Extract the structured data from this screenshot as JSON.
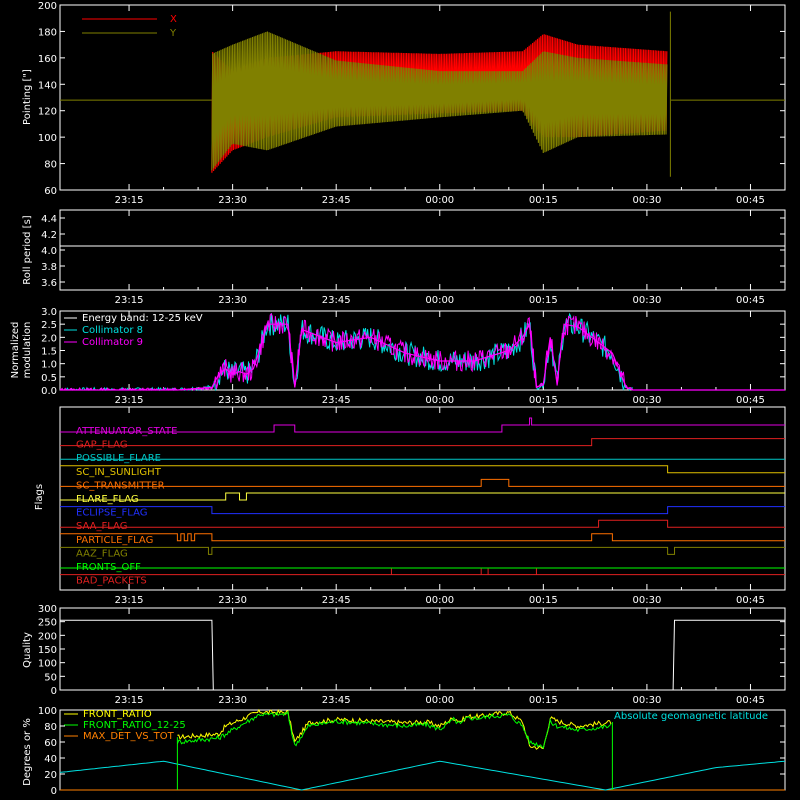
{
  "colors": {
    "background": "#000000",
    "axes": "#ffffff",
    "x_pointing": "#ff0000",
    "y_pointing": "#808000",
    "collimator8": "#00e0e0",
    "collimator9": "#ff00ff",
    "front_ratio": "#ffff00",
    "front_ratio_12_25": "#00ff00",
    "max_det_vs_tot": "#ff8000",
    "geomag": "#00e0e0"
  },
  "time_axis": {
    "ticks": [
      "23:15",
      "23:30",
      "23:45",
      "00:00",
      "00:15",
      "00:30",
      "00:45"
    ],
    "tick_minutes": [
      15,
      30,
      45,
      60,
      75,
      90,
      105
    ],
    "range_minutes": [
      5,
      110
    ]
  },
  "chart_data": [
    {
      "type": "line",
      "panel": "pointing",
      "ylabel": "Pointing [\"]",
      "ylim": [
        60,
        200
      ],
      "yticks": [
        "60",
        "80",
        "100",
        "120",
        "140",
        "160",
        "180",
        "200"
      ],
      "ytick_values": [
        60,
        80,
        100,
        120,
        140,
        160,
        180,
        200
      ],
      "legend_position": "top-left",
      "series": [
        {
          "name": "X",
          "x_min": [
            27,
            30,
            35,
            45,
            60,
            72,
            75,
            80,
            93
          ],
          "upper": [
            165,
            150,
            160,
            165,
            163,
            165,
            178,
            170,
            165
          ],
          "lower": [
            73,
            90,
            100,
            115,
            118,
            120,
            100,
            100,
            105
          ]
        },
        {
          "name": "Y",
          "x_min": [
            27,
            30,
            35,
            45,
            60,
            72,
            75,
            80,
            93
          ],
          "upper": [
            163,
            170,
            180,
            158,
            150,
            150,
            165,
            160,
            155
          ],
          "lower": [
            75,
            95,
            90,
            108,
            115,
            120,
            88,
            100,
            102
          ]
        }
      ],
      "baseline": 128
    },
    {
      "type": "line",
      "panel": "roll",
      "ylabel": "Roll period [s]",
      "ylim": [
        3.5,
        4.5
      ],
      "yticks": [
        "3.6",
        "3.8",
        "4.0",
        "4.2",
        "4.4"
      ],
      "ytick_values": [
        3.6,
        3.8,
        4.0,
        4.2,
        4.4
      ],
      "series": [
        {
          "name": "",
          "x": [
            5,
            110
          ],
          "y": [
            4.05,
            4.05
          ]
        }
      ]
    },
    {
      "type": "line",
      "panel": "modulation",
      "ylabel": [
        "Normalized",
        "modulation"
      ],
      "ylim": [
        0,
        3.0
      ],
      "yticks": [
        "0.0",
        "0.5",
        "1.0",
        "1.5",
        "2.0",
        "2.5",
        "3.0"
      ],
      "ytick_values": [
        0,
        0.5,
        1.0,
        1.5,
        2.0,
        2.5,
        3.0
      ],
      "legend_title": "Energy band: 12-25 keV",
      "legend_position": "top-left",
      "envelope_x": [
        5,
        22,
        27,
        28,
        29,
        30,
        31,
        32,
        33,
        34,
        35,
        38,
        39,
        40,
        45,
        50,
        55,
        60,
        65,
        70,
        72,
        73,
        74,
        75,
        76,
        77,
        78,
        80,
        82,
        85,
        87,
        88,
        110
      ],
      "envelope_y": [
        0,
        0,
        0.1,
        0.6,
        0.8,
        0.6,
        0.7,
        0.6,
        0.8,
        1.6,
        2.5,
        2.5,
        0.1,
        2.3,
        1.8,
        2.0,
        1.4,
        1.1,
        1.1,
        1.5,
        2.0,
        2.5,
        0.1,
        0.2,
        2.0,
        0.3,
        2.5,
        2.4,
        2.0,
        1.4,
        0.1,
        0,
        0
      ],
      "series": [
        {
          "name": "Collimator 8"
        },
        {
          "name": "Collimator 9"
        }
      ]
    },
    {
      "type": "line",
      "panel": "flags",
      "ylabel": "Flags",
      "series": [
        {
          "name": "ATTENUATOR_STATE",
          "color": "#e000e0",
          "steps": [
            [
              5,
              0
            ],
            [
              36,
              1
            ],
            [
              39,
              0
            ],
            [
              69,
              1
            ],
            [
              73,
              2
            ],
            [
              73.3,
              1
            ],
            [
              110,
              1
            ]
          ]
        },
        {
          "name": "GAP_FLAG",
          "color": "#e02020",
          "steps": [
            [
              5,
              0
            ],
            [
              82,
              1
            ],
            [
              110,
              1
            ]
          ]
        },
        {
          "name": "POSSIBLE_FLARE",
          "color": "#00c8c8",
          "steps": [
            [
              5,
              0
            ],
            [
              110,
              0
            ]
          ]
        },
        {
          "name": "SC_IN_SUNLIGHT",
          "color": "#e0c000",
          "steps": [
            [
              5,
              1
            ],
            [
              93,
              0
            ],
            [
              110,
              0
            ]
          ]
        },
        {
          "name": "SC_TRANSMITTER",
          "color": "#ff7000",
          "steps": [
            [
              5,
              0
            ],
            [
              66,
              1
            ],
            [
              70,
              0
            ],
            [
              110,
              0
            ]
          ]
        },
        {
          "name": "FLARE_FLAG",
          "color": "#ffff40",
          "steps": [
            [
              5,
              0
            ],
            [
              29,
              1
            ],
            [
              31,
              0
            ],
            [
              32,
              1
            ],
            [
              110,
              1
            ]
          ]
        },
        {
          "name": "ECLIPSE_FLAG",
          "color": "#2030ff",
          "steps": [
            [
              5,
              1
            ],
            [
              27,
              0
            ],
            [
              93,
              1
            ],
            [
              110,
              1
            ]
          ]
        },
        {
          "name": "SAA_FLAG",
          "color": "#e02020",
          "steps": [
            [
              5,
              0
            ],
            [
              83,
              1
            ],
            [
              93,
              0
            ],
            [
              110,
              0
            ]
          ]
        },
        {
          "name": "PARTICLE_FLAG",
          "color": "#ff7000",
          "steps": [
            [
              5,
              1
            ],
            [
              22,
              0
            ],
            [
              22.5,
              1
            ],
            [
              23,
              0
            ],
            [
              23.5,
              1
            ],
            [
              24,
              0
            ],
            [
              24.5,
              1
            ],
            [
              27,
              0
            ],
            [
              82,
              1
            ],
            [
              85,
              0
            ],
            [
              110,
              0
            ]
          ]
        },
        {
          "name": "AAZ_FLAG",
          "color": "#808000",
          "steps": [
            [
              5,
              1
            ],
            [
              26.5,
              0
            ],
            [
              27,
              1
            ],
            [
              93,
              0
            ],
            [
              94,
              1
            ],
            [
              110,
              1
            ]
          ]
        },
        {
          "name": "FRONTS_OFF",
          "color": "#00ff00",
          "steps": [
            [
              5,
              0
            ],
            [
              110,
              0
            ]
          ]
        },
        {
          "name": "BAD_PACKETS",
          "color": "#e02020",
          "steps": [
            [
              5,
              1
            ],
            [
              110,
              1
            ]
          ],
          "spikes": [
            53,
            66,
            67,
            74
          ]
        }
      ]
    },
    {
      "type": "line",
      "panel": "quality",
      "ylabel": "Quality",
      "ylim": [
        0,
        300
      ],
      "yticks": [
        "0",
        "50",
        "100",
        "150",
        "200",
        "250",
        "300"
      ],
      "ytick_values": [
        0,
        50,
        100,
        150,
        200,
        250,
        300
      ],
      "series": [
        {
          "name": "",
          "x": [
            5,
            27,
            27.2,
            93.8,
            94,
            110
          ],
          "y": [
            255,
            255,
            0,
            0,
            255,
            255
          ]
        }
      ]
    },
    {
      "type": "line",
      "panel": "ratios",
      "ylabel": "Degrees or %",
      "ylim": [
        0,
        100
      ],
      "yticks": [
        "0",
        "20",
        "40",
        "60",
        "80",
        "100"
      ],
      "ytick_values": [
        0,
        20,
        40,
        60,
        80,
        100
      ],
      "annotation": "Absolute geomagnetic latitude",
      "series": [
        {
          "name": "FRONT_RATIO",
          "x": [
            22,
            28,
            29,
            33,
            34,
            35,
            38,
            39,
            41,
            45,
            55,
            58,
            60,
            62,
            63,
            64,
            66,
            67,
            70,
            72,
            73,
            75,
            76,
            77,
            80,
            85
          ],
          "y": [
            66,
            70,
            80,
            95,
            98,
            97,
            97,
            60,
            84,
            88,
            84,
            85,
            80,
            90,
            86,
            92,
            92,
            94,
            97,
            85,
            55,
            52,
            90,
            86,
            80,
            85
          ]
        },
        {
          "name": "FRONT_RATIO_12-25",
          "x": [
            22,
            28,
            29,
            33,
            34,
            35,
            38,
            39,
            41,
            45,
            55,
            58,
            60,
            62,
            63,
            64,
            66,
            67,
            70,
            72,
            73,
            75,
            76,
            77,
            80,
            85
          ],
          "y": [
            60,
            65,
            70,
            90,
            95,
            94,
            95,
            55,
            80,
            86,
            80,
            82,
            76,
            88,
            82,
            90,
            90,
            92,
            94,
            80,
            60,
            55,
            85,
            80,
            75,
            80
          ]
        },
        {
          "name": "MAX_DET_VS_TOT",
          "x": [
            5,
            110
          ],
          "y": [
            0,
            0
          ]
        },
        {
          "name": "Absolute geomagnetic latitude",
          "x": [
            5,
            20,
            40,
            60,
            84,
            100,
            110
          ],
          "y": [
            22,
            36,
            0,
            36,
            0,
            28,
            36
          ]
        }
      ]
    }
  ],
  "legend": {
    "x_label": "X",
    "y_label": "Y",
    "energy_band": "Energy band: 12-25 keV",
    "coll8": "Collimator 8",
    "coll9": "Collimator 9",
    "front_ratio": "FRONT_RATIO",
    "front_ratio_12_25": "FRONT_RATIO_12-25",
    "max_det": "MAX_DET_VS_TOT",
    "geomag": "Absolute geomagnetic latitude"
  },
  "axis_labels": {
    "pointing": "Pointing [\"]",
    "roll": "Roll period [s]",
    "mod1": "Normalized",
    "mod2": "modulation",
    "flags": "Flags",
    "quality": "Quality",
    "ratios": "Degrees or %"
  }
}
